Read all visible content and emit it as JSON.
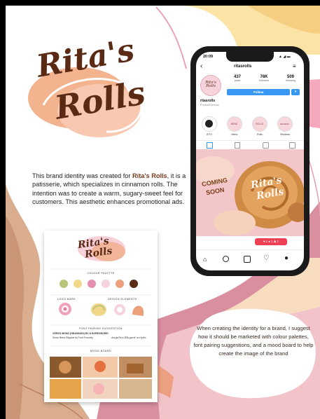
{
  "logo": {
    "line1": "Rita's",
    "line2": "Rolls"
  },
  "intro": {
    "before_brand": "This brand identity was created for ",
    "brand": "Rita's Rolls",
    "after_brand": ", it is a patisserie, which specializes in cinnamon rolls. The intention was to create a warm, sugary-sweet feel for customers. This aesthetic enhances promotional ads."
  },
  "note": "When creating the identity for a brand, I suggest how it should be marketed with colour palettes, font pairing suggestions, and a mood board to help create the image of the brand",
  "phone": {
    "status": {
      "time": "20:09",
      "signal": "▲ ◢ ▬"
    },
    "header": {
      "back": "‹",
      "username": "ritasrolls",
      "menu": "≡"
    },
    "stats": [
      {
        "value": "437",
        "label": "posts"
      },
      {
        "value": "76K",
        "label": "followers"
      },
      {
        "value": "509",
        "label": "following"
      }
    ],
    "follow_label": "Follow",
    "dropdown": "▾",
    "profile_name": "ritasrolls",
    "profile_category": "Product/Service",
    "avatar_text": "Rita's Rolls",
    "highlights": [
      {
        "label": "IGTV",
        "text": ""
      },
      {
        "label": "Menu",
        "text": "MENU"
      },
      {
        "label": "Rolls",
        "text": "ROLLS"
      },
      {
        "label": "Reviews",
        "text": "REVIEWS"
      }
    ],
    "post": {
      "coming": "COMING",
      "soon": "SOON",
      "logo_line1": "Rita's",
      "logo_line2": "Rolls"
    },
    "activity": "♥ 1  ● 1  ♟ 1"
  },
  "card": {
    "logo": {
      "line1": "Rita's",
      "line2": "Rolls"
    },
    "colour_palette": "COLOUR PALETTE",
    "swatches": [
      "#b9c57a",
      "#f2d78a",
      "#e78fb1",
      "#f6d2dc",
      "#eca07c",
      "#5b2b15"
    ],
    "logo_mark": "LOGO MARK",
    "design_elements": "DESIGN ELEMENTS",
    "font_pairing": "FONT PAIRING SUGGESTION",
    "font_sample_1": "VERSO MONO (HEADINGS) BY A DOREGEOREI",
    "font_sample_2": "Snow Neue Regular by Font Foundry",
    "font_sample_3": "Angelica Elegant scripts",
    "mood_board": "MOOD BOARD"
  }
}
